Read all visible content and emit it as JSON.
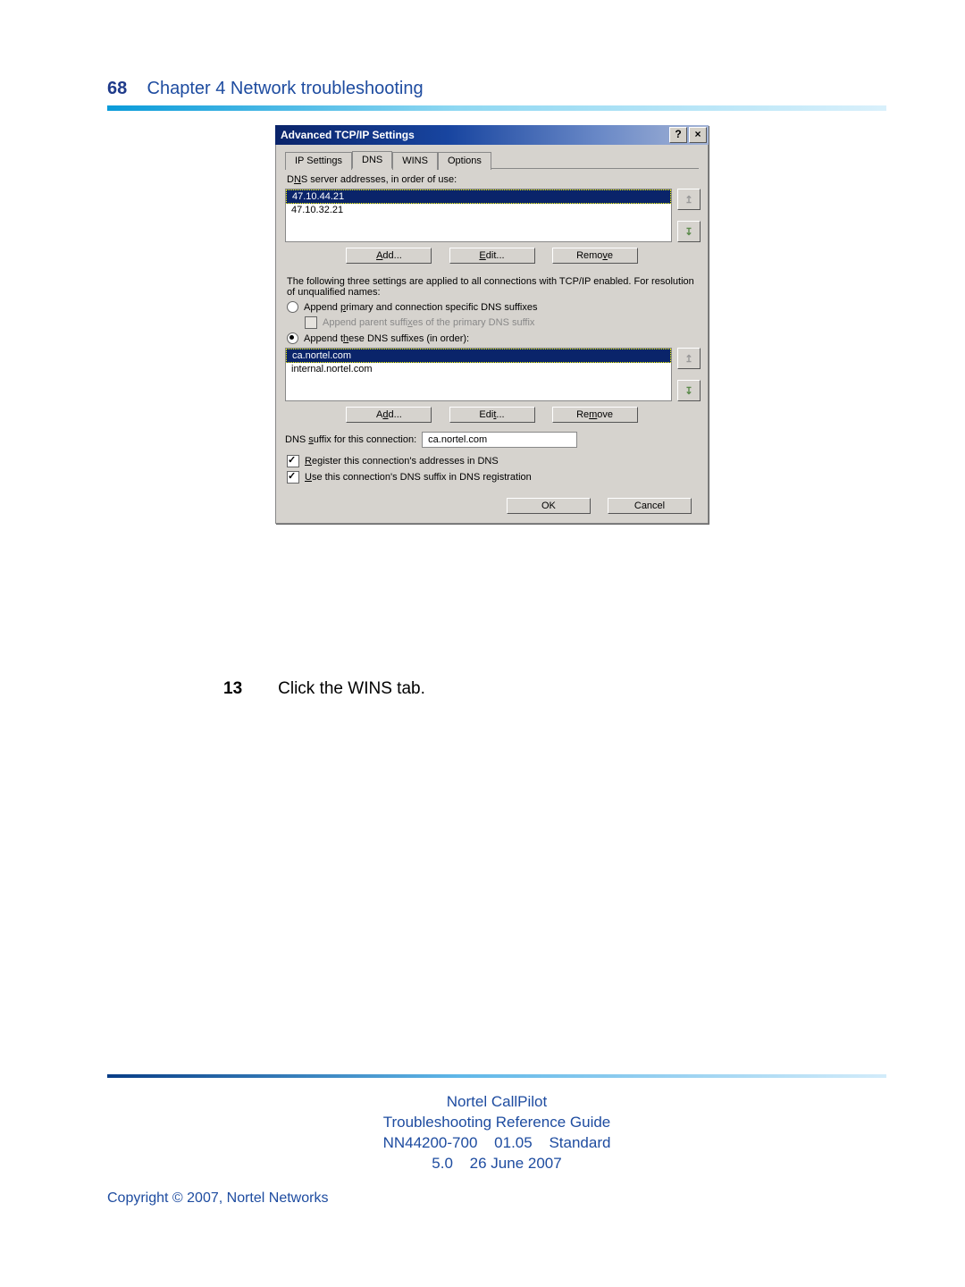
{
  "page": {
    "number": "68",
    "chapter_label": "Chapter 4  Network troubleshooting"
  },
  "dialog": {
    "title": "Advanced TCP/IP Settings",
    "help_btn": "?",
    "close_btn": "×",
    "tabs": [
      "IP Settings",
      "DNS",
      "WINS",
      "Options"
    ],
    "active_tab": "DNS",
    "dns_servers_label": "DNS server addresses, in order of use:",
    "dns_servers": [
      "47.10.44.21",
      "47.10.32.21"
    ],
    "btn_add": "Add...",
    "btn_edit": "Edit...",
    "btn_remove": "Remove",
    "explain": "The following three settings are applied to all connections with TCP/IP enabled. For resolution of unqualified names:",
    "radio_primary": "Append primary and connection specific DNS suffixes",
    "check_parent": "Append parent suffixes of the primary DNS suffix",
    "radio_these": "Append these DNS suffixes (in order):",
    "suffix_list": [
      "ca.nortel.com",
      "internal.nortel.com"
    ],
    "btn_add2": "Add...",
    "btn_edit2": "Edit...",
    "btn_remove2": "Remove",
    "suffix_label": "DNS suffix for this connection:",
    "suffix_value": "ca.nortel.com",
    "check_register": "Register this connection's addresses in DNS",
    "check_use_suffix": "Use this connection's DNS suffix in DNS registration",
    "ok": "OK",
    "cancel": "Cancel"
  },
  "step": {
    "num": "13",
    "text": "Click the WINS tab."
  },
  "footer": {
    "l1": "Nortel CallPilot",
    "l2": "Troubleshooting Reference Guide",
    "l3a": "NN44200-700",
    "l3b": "01.05",
    "l3c": "Standard",
    "l4a": "5.0",
    "l4b": "26 June 2007",
    "copyright": "Copyright © 2007, Nortel Networks"
  }
}
